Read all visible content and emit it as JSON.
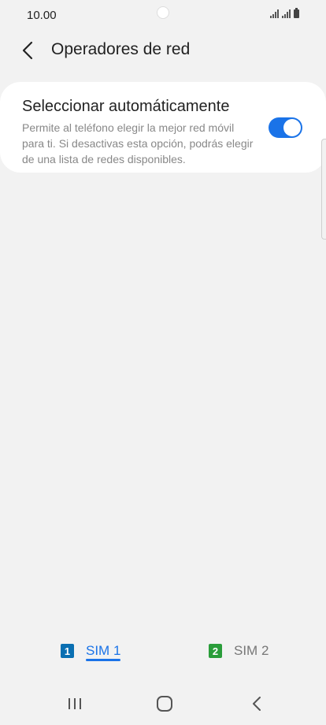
{
  "status_bar": {
    "time": "10.00"
  },
  "header": {
    "title": "Operadores de red"
  },
  "setting": {
    "title": "Seleccionar automáticamente",
    "description": "Permite al teléfono elegir la mejor red móvil para ti. Si desactivas esta opción, podrás elegir de una lista de redes disponibles.",
    "toggle_on": true
  },
  "tabs": [
    {
      "badge": "1",
      "label": "SIM 1",
      "selected": true
    },
    {
      "badge": "2",
      "label": "SIM 2",
      "selected": false
    }
  ],
  "colors": {
    "accent": "#1a73e8",
    "sim1": "#0a6fb2",
    "sim2": "#2a9d3a"
  }
}
